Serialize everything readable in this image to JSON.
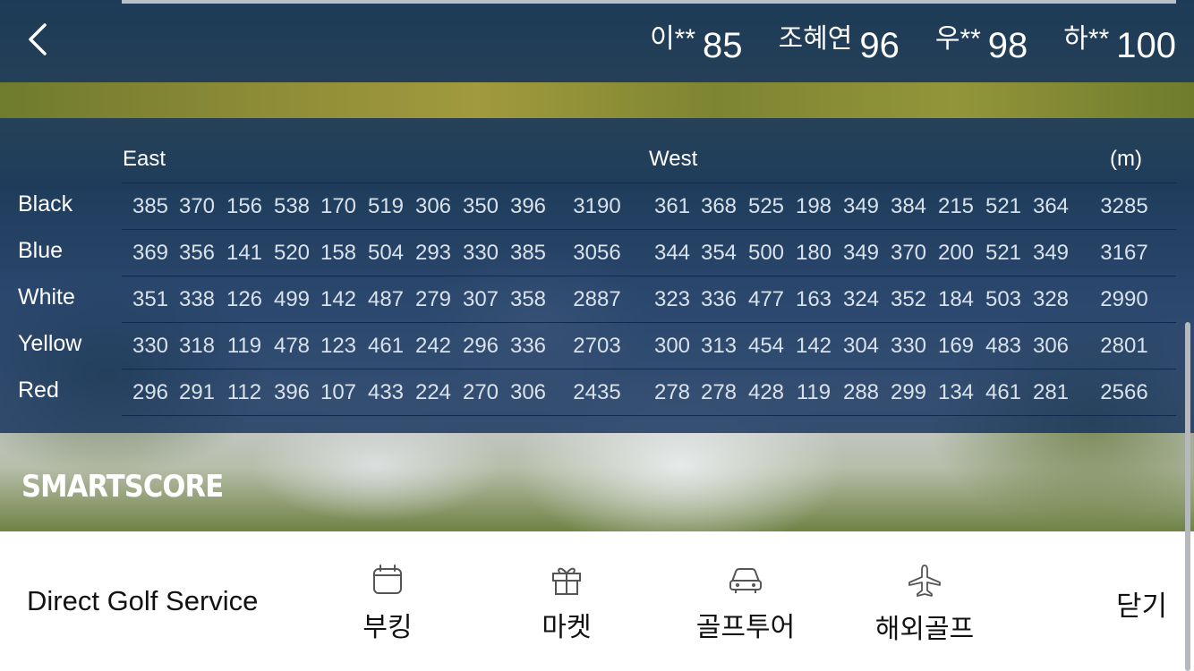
{
  "players": [
    {
      "name": "이**",
      "score": "85"
    },
    {
      "name": "조혜연",
      "score": "96"
    },
    {
      "name": "우**",
      "score": "98"
    },
    {
      "name": "하**",
      "score": "100"
    }
  ],
  "scorecard": {
    "east_label": "East",
    "west_label": "West",
    "unit_label": "(m)",
    "rows": [
      {
        "tee": "Black",
        "east": [
          "385",
          "370",
          "156",
          "538",
          "170",
          "519",
          "306",
          "350",
          "396"
        ],
        "east_total": "3190",
        "west": [
          "361",
          "368",
          "525",
          "198",
          "349",
          "384",
          "215",
          "521",
          "364"
        ],
        "west_total": "3285"
      },
      {
        "tee": "Blue",
        "east": [
          "369",
          "356",
          "141",
          "520",
          "158",
          "504",
          "293",
          "330",
          "385"
        ],
        "east_total": "3056",
        "west": [
          "344",
          "354",
          "500",
          "180",
          "349",
          "370",
          "200",
          "521",
          "349"
        ],
        "west_total": "3167"
      },
      {
        "tee": "White",
        "east": [
          "351",
          "338",
          "126",
          "499",
          "142",
          "487",
          "279",
          "307",
          "358"
        ],
        "east_total": "2887",
        "west": [
          "323",
          "336",
          "477",
          "163",
          "324",
          "352",
          "184",
          "503",
          "328"
        ],
        "west_total": "2990"
      },
      {
        "tee": "Yellow",
        "east": [
          "330",
          "318",
          "119",
          "478",
          "123",
          "461",
          "242",
          "296",
          "336"
        ],
        "east_total": "2703",
        "west": [
          "300",
          "313",
          "454",
          "142",
          "304",
          "330",
          "169",
          "483",
          "306"
        ],
        "west_total": "2801"
      },
      {
        "tee": "Red",
        "east": [
          "296",
          "291",
          "112",
          "396",
          "107",
          "433",
          "224",
          "270",
          "306"
        ],
        "east_total": "2435",
        "west": [
          "278",
          "278",
          "428",
          "119",
          "288",
          "299",
          "134",
          "461",
          "281"
        ],
        "west_total": "2566"
      }
    ]
  },
  "brand": "SMARTSCORE",
  "bottom": {
    "service_title": "Direct Golf Service",
    "nav": [
      {
        "label": "부킹",
        "icon": "calendar-icon"
      },
      {
        "label": "마켓",
        "icon": "gift-icon"
      },
      {
        "label": "골프투어",
        "icon": "car-icon"
      },
      {
        "label": "해외골프",
        "icon": "airplane-icon"
      }
    ],
    "close_label": "닫기"
  },
  "colors": {
    "overlay": "#16345e",
    "text_light": "#d9e1ea"
  }
}
